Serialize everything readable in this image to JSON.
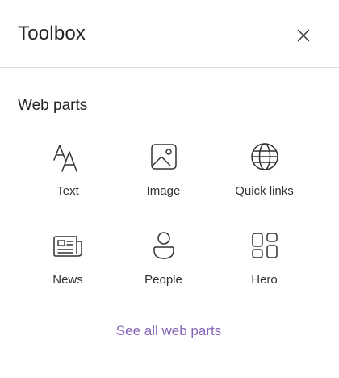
{
  "panel": {
    "title": "Toolbox",
    "close_icon": "close-icon"
  },
  "section": {
    "title": "Web parts"
  },
  "web_parts": [
    {
      "label": "Text",
      "icon": "text-icon"
    },
    {
      "label": "Image",
      "icon": "image-icon"
    },
    {
      "label": "Quick links",
      "icon": "globe-icon"
    },
    {
      "label": "News",
      "icon": "news-icon"
    },
    {
      "label": "People",
      "icon": "people-icon"
    },
    {
      "label": "Hero",
      "icon": "hero-icon"
    }
  ],
  "footer": {
    "see_all_label": "See all web parts"
  },
  "colors": {
    "link": "#8764b8",
    "text": "#242424",
    "divider": "#dcdcdc"
  }
}
